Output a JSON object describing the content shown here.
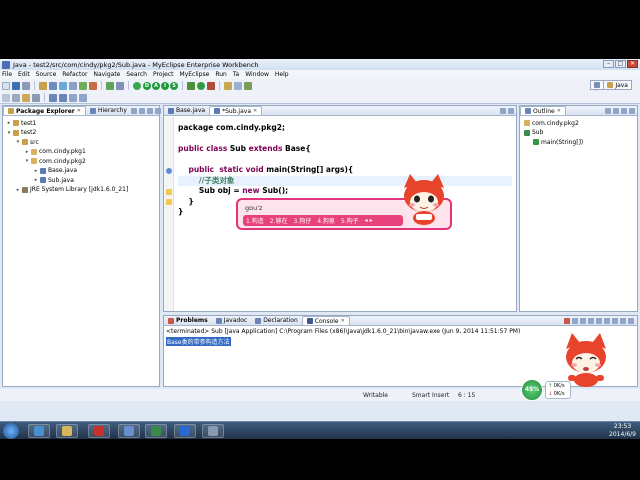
{
  "window": {
    "title": "Java - test2/src/com/cindy/pkg2/Sub.java - MyEclipse Enterprise Workbench",
    "buttons": {
      "minimize": "–",
      "maximize": "□",
      "close": "✕"
    }
  },
  "menu": [
    "File",
    "Edit",
    "Source",
    "Refactor",
    "Navigate",
    "Search",
    "Project",
    "MyEclipse",
    "Run",
    "Ta",
    "Window",
    "Help"
  ],
  "toolbar": {
    "dais": [
      "D",
      "A",
      "I",
      "S"
    ],
    "perspective": "Java"
  },
  "package_explorer": {
    "tabs": [
      "Package Explorer",
      "Hierarchy"
    ],
    "tree": [
      {
        "label": "test1",
        "depth": 0,
        "twisty": "▸",
        "icon": "project-icon"
      },
      {
        "label": "test2",
        "depth": 0,
        "twisty": "▾",
        "icon": "project-icon"
      },
      {
        "label": "src",
        "depth": 1,
        "twisty": "▾",
        "icon": "source-folder-icon"
      },
      {
        "label": "com.cindy.pkg1",
        "depth": 2,
        "twisty": "▸",
        "icon": "package-icon"
      },
      {
        "label": "com.cindy.pkg2",
        "depth": 2,
        "twisty": "▾",
        "icon": "package-icon"
      },
      {
        "label": "Base.java",
        "depth": 3,
        "twisty": "▸",
        "icon": "java-file-icon"
      },
      {
        "label": "Sub.java",
        "depth": 3,
        "twisty": "▸",
        "icon": "java-file-icon"
      },
      {
        "label": "JRE System Library [jdk1.6.0_21]",
        "depth": 1,
        "twisty": "▸",
        "icon": "library-icon"
      }
    ]
  },
  "editor": {
    "tabs": [
      "Base.java",
      "*Sub.java"
    ],
    "lines": [
      {
        "parts": [
          {
            "t": "package com.cindy.pkg2;",
            "c": ""
          }
        ]
      },
      {
        "parts": []
      },
      {
        "parts": [
          {
            "t": "public class ",
            "c": "kw"
          },
          {
            "t": "Sub ",
            "c": ""
          },
          {
            "t": "extends ",
            "c": "kw"
          },
          {
            "t": "Base{",
            "c": ""
          }
        ]
      },
      {
        "parts": []
      },
      {
        "parts": [
          {
            "t": "    public  static void ",
            "c": "kw"
          },
          {
            "t": "main(String[] args){",
            "c": ""
          }
        ]
      },
      {
        "parts": [
          {
            "t": "        //子类对象",
            "c": "cm"
          }
        ]
      },
      {
        "parts": [
          {
            "t": "        Sub obj = ",
            "c": ""
          },
          {
            "t": "new ",
            "c": "kw"
          },
          {
            "t": "Sub();",
            "c": ""
          }
        ]
      },
      {
        "parts": [
          {
            "t": "    }",
            "c": ""
          }
        ]
      },
      {
        "parts": [
          {
            "t": "}",
            "c": ""
          }
        ]
      }
    ]
  },
  "ime": {
    "composition": "gou'z",
    "candidates": [
      "1.构造",
      "2.够在",
      "3.狗仔",
      "4.狗崽",
      "5.构子"
    ],
    "page_arrows": "◂ ▸"
  },
  "outline": {
    "tab": "Outline",
    "tree": [
      {
        "label": "com.cindy.pkg2",
        "depth": 0,
        "icon": "package-icon"
      },
      {
        "label": "Sub",
        "depth": 0,
        "icon": "class-icon"
      },
      {
        "label": "main(String[])",
        "depth": 1,
        "icon": "method-icon"
      }
    ]
  },
  "console": {
    "tabs": [
      "Problems",
      "Javadoc",
      "Declaration",
      "Console"
    ],
    "header": "<terminated> Sub [Java Application] C:\\Program Files (x86)\\Java\\jdk1.6.0_21\\bin\\javaw.exe (Jun 9, 2014 11:51:57 PM)",
    "output": "Base类的带参构造方法"
  },
  "status": {
    "writable": "Writable",
    "insert": "Smart Insert",
    "position": "6 : 15"
  },
  "widget": {
    "percent": "45%",
    "up": "0K/s",
    "down": "0K/s"
  },
  "taskbar": {
    "time": "23:53",
    "date": "2014/6/9"
  }
}
